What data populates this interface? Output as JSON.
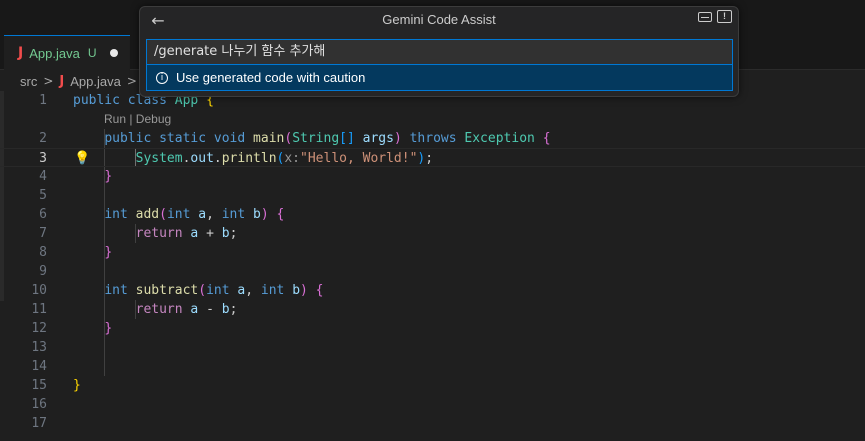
{
  "tab": {
    "icon": "java-icon",
    "icon_glyph": "J",
    "name": "App.java",
    "status": "U"
  },
  "breadcrumb": {
    "folder": "src",
    "sep": ">",
    "file": "App.java",
    "icon_glyph": "J"
  },
  "codelens": {
    "text": "Run | Debug"
  },
  "gemini": {
    "back_glyph": "←",
    "title": "Gemini Code Assist",
    "input_value": "/generate 나누기 함수 추가해",
    "caution": "Use generated code with caution",
    "info_glyph": "i",
    "feedback_glyph": "!"
  },
  "lines": {
    "n1": "1",
    "n2": "2",
    "n3": "3",
    "n4": "4",
    "n5": "5",
    "n6": "6",
    "n7": "7",
    "n8": "8",
    "n9": "9",
    "n10": "10",
    "n11": "11",
    "n12": "12",
    "n13": "13",
    "n14": "14",
    "n15": "15",
    "n16": "16",
    "n17": "17"
  },
  "code": {
    "l1_public": "public",
    "l1_class": "class",
    "l1_name": "App",
    "l1_brace": "{",
    "l2_public": "public",
    "l2_static": "static",
    "l2_void": "void",
    "l2_main": "main",
    "l2_lp": "(",
    "l2_string": "String",
    "l2_arr": "[]",
    "l2_args": "args",
    "l2_rp": ")",
    "l2_throws": "throws",
    "l2_exc": "Exception",
    "l2_brace": "{",
    "l3_system": "System",
    "l3_dot1": ".",
    "l3_out": "out",
    "l3_dot2": ".",
    "l3_println": "println",
    "l3_lp": "(",
    "l3_hint": "x:",
    "l3_str": "\"Hello, World!\"",
    "l3_rp": ")",
    "l3_semi": ";",
    "l4_brace": "}",
    "l6_int": "int",
    "l6_add": "add",
    "l6_lp": "(",
    "l6_int2": "int",
    "l6_a": "a",
    "l6_comma": ",",
    "l6_int3": "int",
    "l6_b": "b",
    "l6_rp": ")",
    "l6_brace": "{",
    "l7_return": "return",
    "l7_a": "a",
    "l7_op": "+",
    "l7_b": "b",
    "l7_semi": ";",
    "l8_brace": "}",
    "l10_int": "int",
    "l10_sub": "subtract",
    "l10_lp": "(",
    "l10_int2": "int",
    "l10_a": "a",
    "l10_comma": ",",
    "l10_int3": "int",
    "l10_b": "b",
    "l10_rp": ")",
    "l10_brace": "{",
    "l11_return": "return",
    "l11_a": "a",
    "l11_op": "-",
    "l11_b": "b",
    "l11_semi": ";",
    "l12_brace": "}",
    "l15_brace": "}"
  },
  "bulb_glyph": "💡"
}
